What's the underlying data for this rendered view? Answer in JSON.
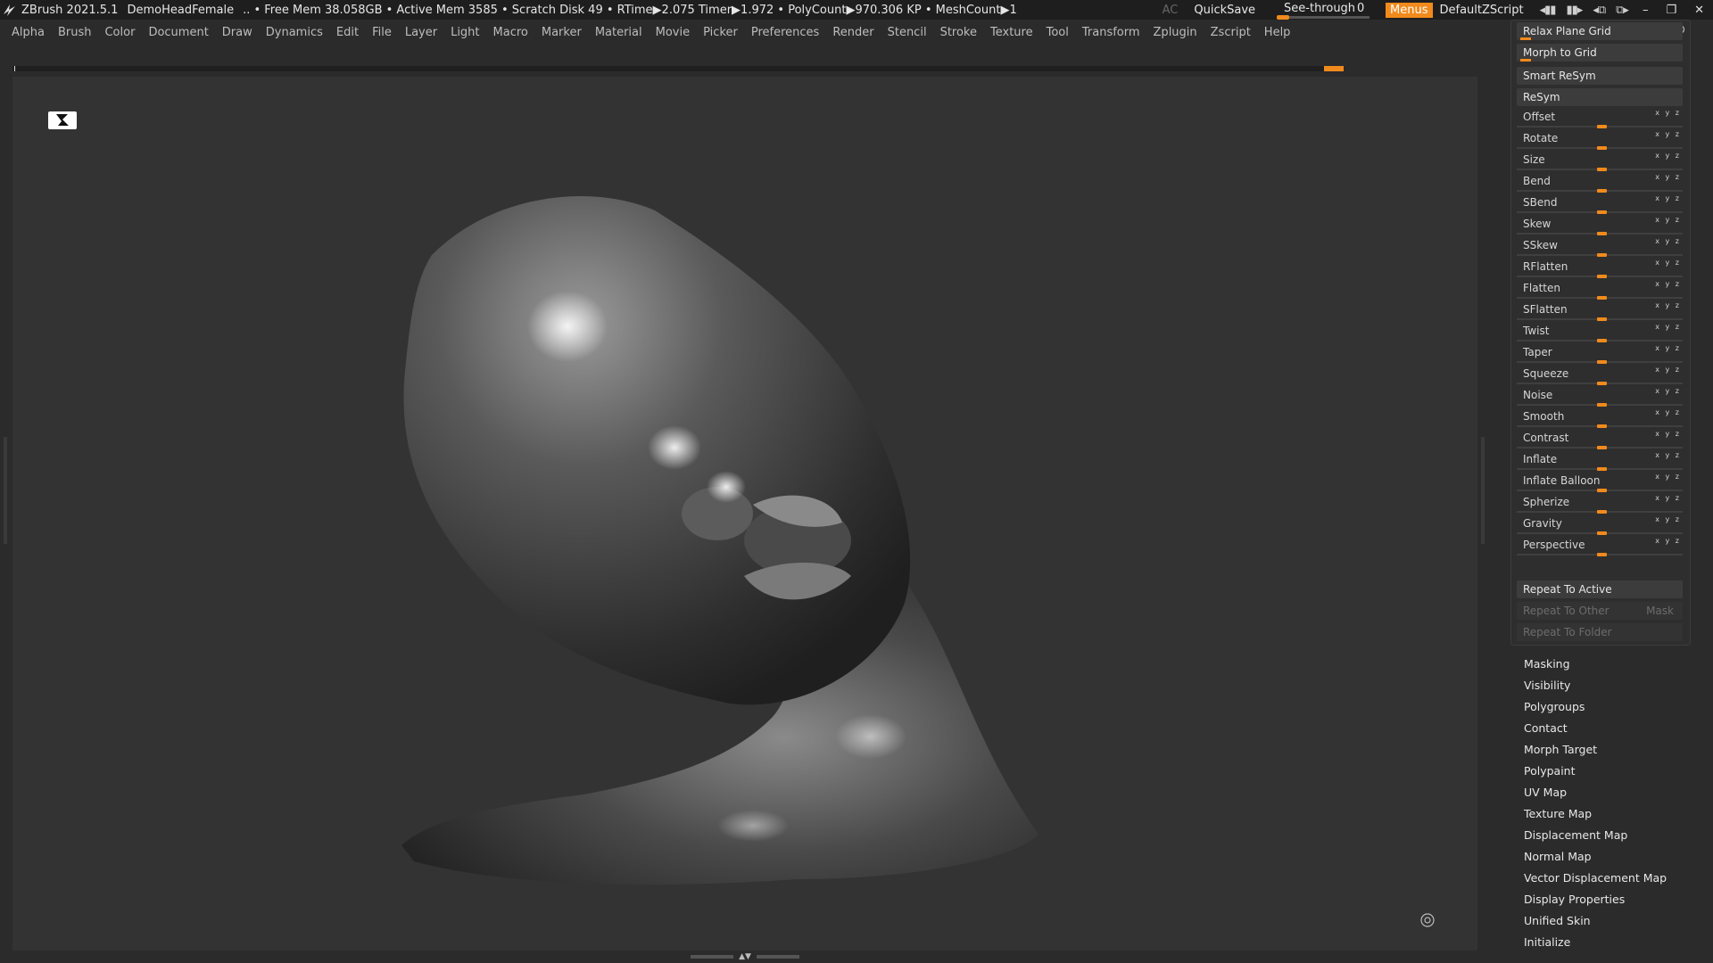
{
  "titlebar": {
    "app": "ZBrush 2021.5.1",
    "document": "DemoHeadFemale",
    "stats": "..  • Free Mem 38.058GB • Active Mem 3585 • Scratch Disk 49 •  RTime▶2.075 Timer▶1.972 • PolyCount▶970.306 KP  • MeshCount▶1",
    "ac": "AC",
    "quicksave": "QuickSave",
    "seethrough_label": "See-through",
    "seethrough_value": "0",
    "menus": "Menus",
    "default_zscript": "DefaultZScript",
    "accent_color": "#f18a1c"
  },
  "menubar": [
    "Alpha",
    "Brush",
    "Color",
    "Document",
    "Draw",
    "Dynamics",
    "Edit",
    "File",
    "Layer",
    "Light",
    "Macro",
    "Marker",
    "Material",
    "Movie",
    "Picker",
    "Preferences",
    "Render",
    "Stencil",
    "Stroke",
    "Texture",
    "Tool",
    "Transform",
    "Zplugin",
    "Zscript",
    "Help"
  ],
  "palette": {
    "relax_plane_grid": "Relax Plane Grid",
    "morph_to_grid": "Morph to Grid",
    "smart_resym": "Smart ReSym",
    "resym": "ReSym",
    "sliders": [
      {
        "label": "Offset",
        "xyz": "x y z"
      },
      {
        "label": "Rotate",
        "xyz": "x y z"
      },
      {
        "label": "Size",
        "xyz": "x y z"
      },
      {
        "label": "Bend",
        "xyz": "x y z"
      },
      {
        "label": "SBend",
        "xyz": "x y z"
      },
      {
        "label": "Skew",
        "xyz": "x y z"
      },
      {
        "label": "SSkew",
        "xyz": "x y z"
      },
      {
        "label": "RFlatten",
        "xyz": "x y z"
      },
      {
        "label": "Flatten",
        "xyz": "x y z"
      },
      {
        "label": "SFlatten",
        "xyz": "x y z"
      },
      {
        "label": "Twist",
        "xyz": "x y z"
      },
      {
        "label": "Taper",
        "xyz": "x y z"
      },
      {
        "label": "Squeeze",
        "xyz": "x y z"
      },
      {
        "label": "Noise",
        "xyz": "x y z"
      },
      {
        "label": "Smooth",
        "xyz": "x y z"
      },
      {
        "label": "Contrast",
        "xyz": "x y z"
      },
      {
        "label": "Inflate",
        "xyz": "x y z"
      },
      {
        "label": "Inflate Balloon",
        "xyz": "x y z"
      },
      {
        "label": "Spherize",
        "xyz": "x y z"
      },
      {
        "label": "Gravity",
        "xyz": "x y z"
      },
      {
        "label": "Perspective",
        "xyz": "x y z"
      }
    ],
    "repeat_to_active": "Repeat To Active",
    "repeat_to_other": "Repeat To Other",
    "mask": "Mask",
    "repeat_to_folder": "Repeat To Folder"
  },
  "subpalettes": [
    "Masking",
    "Visibility",
    "Polygroups",
    "Contact",
    "Morph Target",
    "Polypaint",
    "UV Map",
    "Texture Map",
    "Displacement Map",
    "Normal Map",
    "Vector Displacement Map",
    "Display Properties",
    "Unified Skin",
    "Initialize"
  ]
}
